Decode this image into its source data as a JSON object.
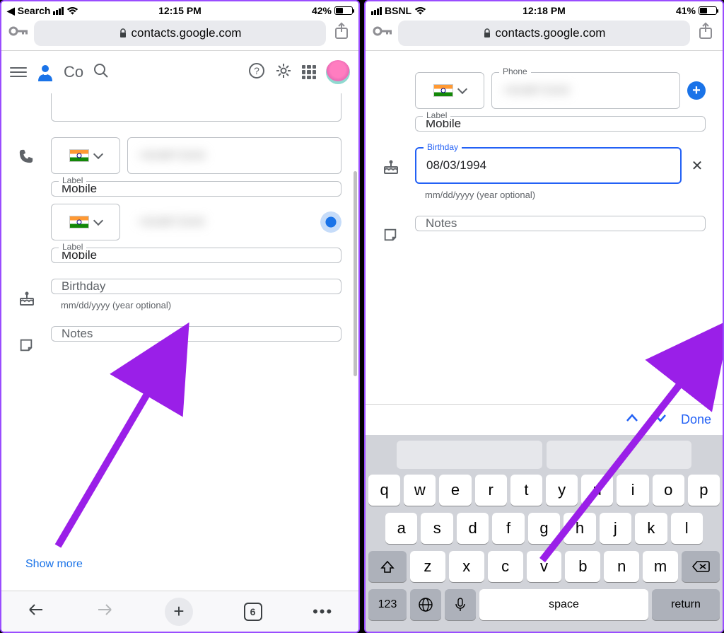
{
  "left": {
    "status": {
      "back_app": "Search",
      "time": "12:15 PM",
      "battery_pct": "42%",
      "battery_fill_pct": 42
    },
    "url": "contacts.google.com",
    "header": {
      "app_short": "Co"
    },
    "phone1": {
      "label_legend": "Label",
      "label_value": "Mobile"
    },
    "phone2": {
      "label_legend": "Label",
      "label_value": "Mobile"
    },
    "birthday": {
      "placeholder": "Birthday",
      "hint": "mm/dd/yyyy (year optional)"
    },
    "notes": {
      "placeholder": "Notes"
    },
    "show_more": "Show more",
    "tab_count": "6"
  },
  "right": {
    "status": {
      "carrier": "BSNL",
      "time": "12:18 PM",
      "battery_pct": "41%",
      "battery_fill_pct": 41
    },
    "url": "contacts.google.com",
    "phone": {
      "legend": "Phone",
      "label_legend": "Label",
      "label_value": "Mobile"
    },
    "birthday": {
      "legend": "Birthday",
      "value": "08/03/1994",
      "hint": "mm/dd/yyyy (year optional)"
    },
    "notes": {
      "placeholder": "Notes"
    },
    "kb": {
      "done": "Done",
      "row1": [
        "q",
        "w",
        "e",
        "r",
        "t",
        "y",
        "u",
        "i",
        "o",
        "p"
      ],
      "row2": [
        "a",
        "s",
        "d",
        "f",
        "g",
        "h",
        "j",
        "k",
        "l"
      ],
      "row3": [
        "z",
        "x",
        "c",
        "v",
        "b",
        "n",
        "m"
      ],
      "num": "123",
      "space": "space",
      "ret": "return"
    }
  }
}
